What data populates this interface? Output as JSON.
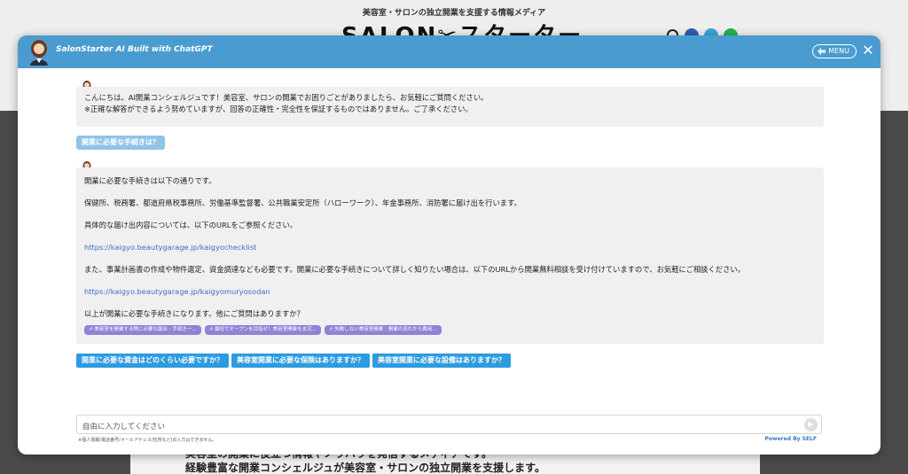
{
  "background": {
    "tagline": "美容室・サロンの独立開業を支援する情報メディア",
    "logo": "SALON✂スターター",
    "bottom_line1": "美容室の開業に役立つ情報やノウハウを発信するメディアです。",
    "bottom_line2": "経験豊富な開業コンシェルジュが美容室・サロンの独立開業を支援します。"
  },
  "modal": {
    "title": "SalonStarter AI Built with ChatGPT",
    "menu_label": "MENU",
    "close_label": "✕"
  },
  "chat": {
    "greeting": [
      "こんにちは。AI開業コンシェルジュです！美容室、サロンの開業でお困りごとがありましたら、お気軽にご質問ください。",
      "※正確な解答ができるよう努めていますが、回答の正確性・完全性を保証するものではありません。ご了承ください。"
    ],
    "user_message": "開業に必要な手続きは？",
    "answer": {
      "p1": "開業に必要な手続きは以下の通りです。",
      "p2": "保健所、税務署、都道府県税事務所、労働基準監督署、公共職業安定所（ハローワーク）、年金事務所、消防署に届け出を行います。",
      "p3": "具体的な届け出内容については、以下のURLをご参照ください。",
      "link1": "https://kaigyo.beautygarage.jp/kaigyochecklist",
      "p4": "また、事業計画書の作成や物件選定、資金調達なども必要です。開業に必要な手続きについて詳しく知りたい場合は、以下のURLから開業無料相談を受け付けていますので、お気軽にご相談ください。",
      "link2": "https://kaigyo.beautygarage.jp/kaigyomuryosodan",
      "p5": "以上が開業に必要な手続きになります。他にご質問はありますか？"
    },
    "chips": [
      "⇗ 美容室を開業する際に必要な届出・手続きー...",
      "⇗ 最短でオープンを目指せ！美容室開業を支究...",
      "⇗ 失敗しない美容室開業｜開業の流れから費用..."
    ],
    "suggestions": [
      "開業に必要な資金はどのくらい必要ですか？",
      "美容室開業に必要な保険はありますか？",
      "美容室開業に必要な設備はありますか？"
    ]
  },
  "input": {
    "placeholder": "自由に入力してください",
    "note": "※個人情報(電話番号/メールアドレス/住所など)の入力はできません。",
    "powered": "Powered By SELF"
  },
  "colors": {
    "header": "#4a9cd0",
    "suggest": "#2e9be0",
    "chip": "#9082d8",
    "user_bubble": "#8fc4e6",
    "link": "#3b6fc4"
  }
}
